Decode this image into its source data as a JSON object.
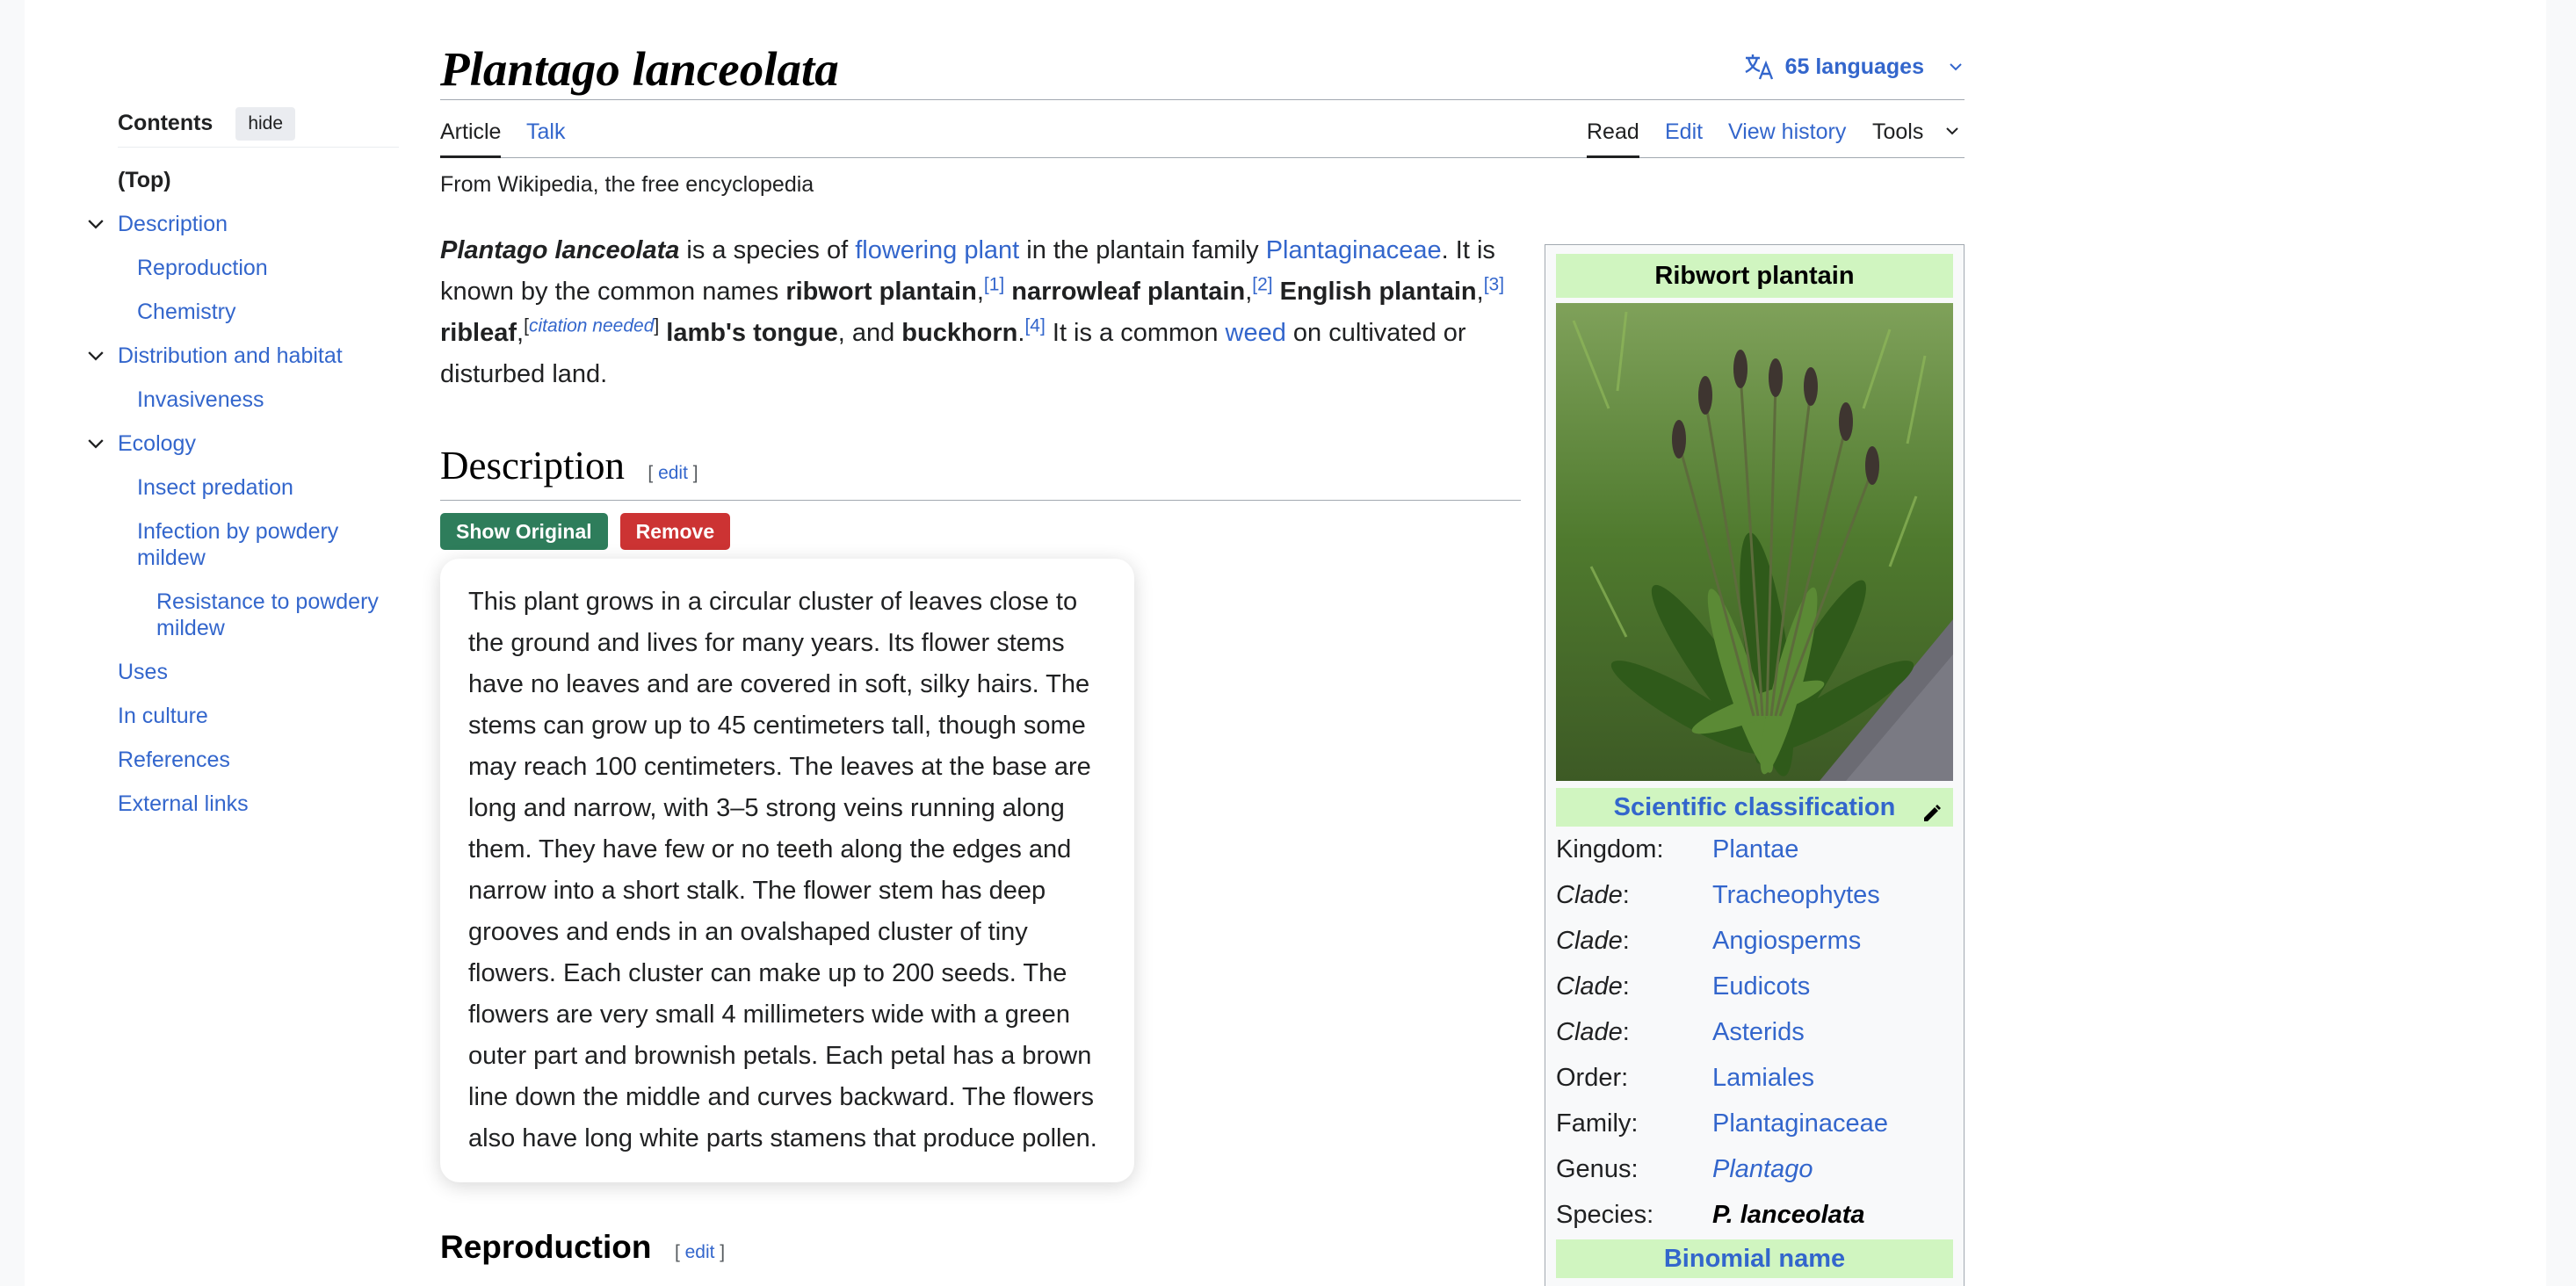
{
  "toc": {
    "title": "Contents",
    "hide": "hide",
    "items": [
      {
        "label": "(Top)"
      },
      {
        "label": "Description"
      },
      {
        "label": "Reproduction"
      },
      {
        "label": "Chemistry"
      },
      {
        "label": "Distribution and habitat"
      },
      {
        "label": "Invasiveness"
      },
      {
        "label": "Ecology"
      },
      {
        "label": "Insect predation"
      },
      {
        "label": "Infection by powdery mildew"
      },
      {
        "label": "Resistance to powdery mildew"
      },
      {
        "label": "Uses"
      },
      {
        "label": "In culture"
      },
      {
        "label": "References"
      },
      {
        "label": "External links"
      }
    ]
  },
  "header": {
    "title": "Plantago lanceolata",
    "languages": "65 languages"
  },
  "tabs": {
    "article": "Article",
    "talk": "Talk",
    "read": "Read",
    "edit": "Edit",
    "history": "View history",
    "tools": "Tools"
  },
  "tagline": "From Wikipedia, the free encyclopedia",
  "lead": {
    "name": "Plantago lanceolata",
    "t1": " is a species of ",
    "l1": "flowering plant",
    "t2": " in the plantain family ",
    "l2": "Plantaginaceae",
    "t3": ". It is known by the common names ",
    "b1": "ribwort plantain",
    "r1": "[1]",
    "b2": "narrowleaf plantain",
    "r2": "[2]",
    "b3": "English plantain",
    "r3": "[3]",
    "b4": "ribleaf",
    "cn": "citation needed",
    "b5": "lamb's tongue",
    "t4": ", and ",
    "b6": "buckhorn",
    "r4": "[4]",
    "t5": " It is a common ",
    "l3": "weed",
    "t6": " on cultivated or disturbed land."
  },
  "description": {
    "heading": "Description",
    "edit": "edit",
    "show_original": "Show Original",
    "remove": "Remove",
    "text": "This plant grows in a circular cluster of leaves close to the ground and lives for many years. Its flower stems have no leaves and are covered in soft, silky hairs. The stems can grow up to 45 centimeters tall, though some may reach 100 centimeters. The leaves at the base are long and narrow, with 3–5 strong veins running along them. They have few or no teeth along the edges and narrow into a short stalk. The flower stem has deep grooves and ends in an ovalshaped cluster of tiny flowers. Each cluster can make up to 200 seeds. The flowers are very small 4 millimeters wide with a green outer part and brownish petals. Each petal has a brown line down the middle and curves backward. The flowers also have long white parts stamens that produce pollen."
  },
  "reproduction": {
    "heading": "Reproduction",
    "edit": "edit"
  },
  "infobox": {
    "caption": "Ribwort plantain",
    "classification": "Scientific classification",
    "rows": [
      {
        "label": "Kingdom:",
        "value": "Plantae"
      },
      {
        "label": "Clade",
        "value": "Tracheophytes"
      },
      {
        "label": "Clade",
        "value": "Angiosperms"
      },
      {
        "label": "Clade",
        "value": "Eudicots"
      },
      {
        "label": "Clade",
        "value": "Asterids"
      },
      {
        "label": "Order:",
        "value": "Lamiales"
      },
      {
        "label": "Family:",
        "value": "Plantaginaceae"
      },
      {
        "label": "Genus:",
        "value": "Plantago"
      },
      {
        "label": "Species:",
        "value": "P. lanceolata"
      }
    ],
    "binomial": "Binomial name"
  },
  "colors": {
    "link": "#3366cc",
    "infobox_header": "#d0f5c0",
    "show_original": "#2e7d5b",
    "remove": "#cc3333"
  }
}
